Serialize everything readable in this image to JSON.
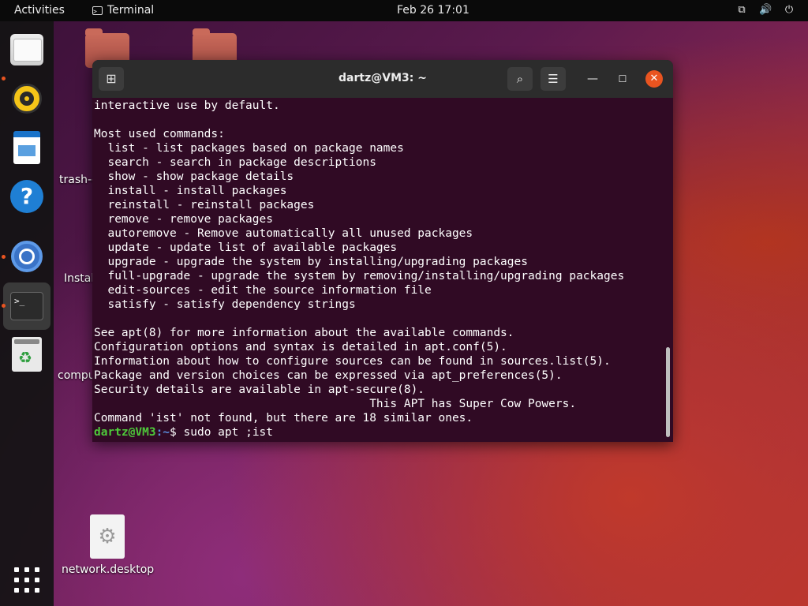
{
  "topbar": {
    "activities": "Activities",
    "app_name": "Terminal",
    "app_icon": "terminal-icon",
    "clock": "Feb 26  17:01",
    "tray_icons": [
      "network-icon",
      "volume-icon",
      "power-icon"
    ]
  },
  "dock": {
    "items": [
      {
        "name": "Files",
        "icon": "files-icon",
        "running": true
      },
      {
        "name": "Rhythmbox",
        "icon": "rhythmbox-icon",
        "running": false
      },
      {
        "name": "LibreOffice Writer",
        "icon": "writer-icon",
        "running": false
      },
      {
        "name": "Help",
        "icon": "help-icon",
        "running": false
      },
      {
        "name": "Chromium",
        "icon": "chromium-icon",
        "running": true
      },
      {
        "name": "Terminal",
        "icon": "terminal-icon",
        "running": true,
        "active": true
      },
      {
        "name": "Trash",
        "icon": "trash-icon",
        "running": false
      }
    ],
    "show_apps_icon": "apps-grid-icon"
  },
  "desktop": {
    "icons": [
      {
        "label": "trash-c",
        "icon": "trash-icon"
      },
      {
        "label": "Instal",
        "icon": "installer-icon"
      },
      {
        "label": "compu",
        "icon": "computer-icon"
      },
      {
        "label": "network.desktop",
        "icon": "gear-icon"
      }
    ]
  },
  "terminal": {
    "title": "dartz@VM3: ~",
    "lines": [
      "interactive use by default.",
      "",
      "Most used commands:",
      "  list - list packages based on package names",
      "  search - search in package descriptions",
      "  show - show package details",
      "  install - install packages",
      "  reinstall - reinstall packages",
      "  remove - remove packages",
      "  autoremove - Remove automatically all unused packages",
      "  update - update list of available packages",
      "  upgrade - upgrade the system by installing/upgrading packages",
      "  full-upgrade - upgrade the system by removing/installing/upgrading packages",
      "  edit-sources - edit the source information file",
      "  satisfy - satisfy dependency strings",
      "",
      "See apt(8) for more information about the available commands.",
      "Configuration options and syntax is detailed in apt.conf(5).",
      "Information about how to configure sources can be found in sources.list(5).",
      "Package and version choices can be expressed via apt_preferences(5).",
      "Security details are available in apt-secure(8).",
      "                                        This APT has Super Cow Powers.",
      "Command 'ist' not found, but there are 18 similar ones."
    ],
    "prompt": {
      "user_host": "dartz@VM3",
      "path": ":~",
      "symbol": "$ ",
      "command": "sudo apt ;ist"
    }
  }
}
